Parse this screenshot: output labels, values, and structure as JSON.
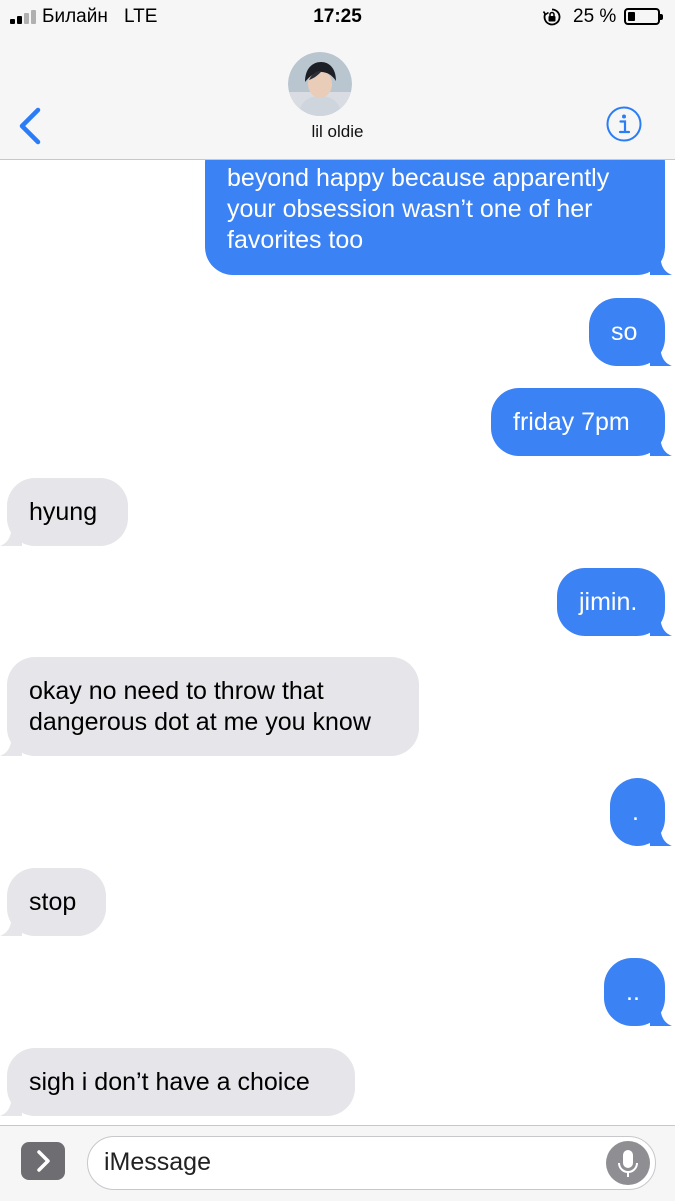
{
  "status_bar": {
    "carrier": "Билайн",
    "network": "LTE",
    "time": "17:25",
    "battery": "25 %",
    "battery_level": 0.25
  },
  "header": {
    "contact_name": "lil oldie",
    "back_icon": "chevron-left-icon",
    "info_icon": "info-icon",
    "accent_color": "#2a7df6"
  },
  "messages": [
    {
      "from": "me",
      "text": "beyond happy because apparently\nyour obsession wasn’t one of her\nfavorites too"
    },
    {
      "from": "me",
      "text": "so"
    },
    {
      "from": "me",
      "text": "friday 7pm"
    },
    {
      "from": "them",
      "text": "hyung"
    },
    {
      "from": "me",
      "text": "jimin."
    },
    {
      "from": "them",
      "text": "okay no need to throw that\ndangerous dot at me you know"
    },
    {
      "from": "me",
      "text": "."
    },
    {
      "from": "them",
      "text": "stop"
    },
    {
      "from": "me",
      "text": ".."
    },
    {
      "from": "them",
      "text": "sigh i don’t have a choice"
    }
  ],
  "input": {
    "placeholder": "iMessage",
    "apps_icon": "chevron-right-icon",
    "mic_icon": "microphone-icon"
  },
  "colors": {
    "sent_bubble": "#3b82f5",
    "received_bubble": "#e5e5ea"
  }
}
